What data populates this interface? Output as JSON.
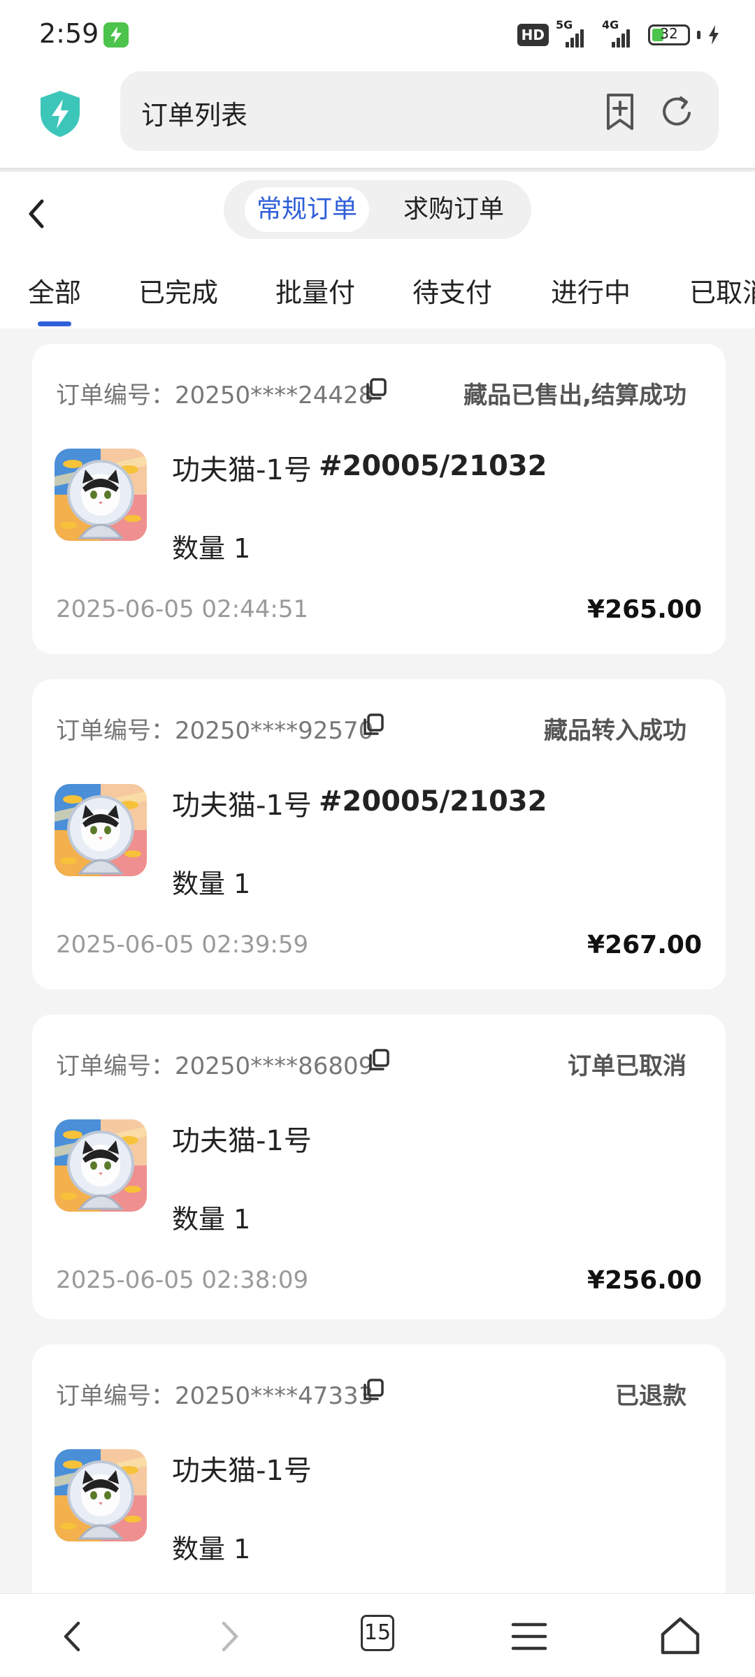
{
  "status_bar": {
    "time": "2:59",
    "network": "HD",
    "signal1": "5G",
    "signal2": "4G",
    "battery": "32"
  },
  "browser": {
    "url_title": "订单列表",
    "tab_count": "15"
  },
  "header": {
    "segments": [
      "常规订单",
      "求购订单"
    ],
    "active_segment": "常规订单",
    "tabs": [
      "全部",
      "已完成",
      "批量付",
      "待支付",
      "进行中",
      "已取消"
    ],
    "active_tab": "全部"
  },
  "orders": [
    {
      "label": "订单编号：20250****24428",
      "status": "藏品已售出,结算成功",
      "name": "功夫猫-1号",
      "serial": "#20005/21032",
      "qty": "数量 1",
      "date": "2025-06-05 02:44:51",
      "price": "¥265.00"
    },
    {
      "label": "订单编号：20250****92570",
      "status": "藏品转入成功",
      "name": "功夫猫-1号",
      "serial": "#20005/21032",
      "qty": "数量 1",
      "date": "2025-06-05 02:39:59",
      "price": "¥267.00"
    },
    {
      "label": "订单编号：20250****86809",
      "status": "订单已取消",
      "name": "功夫猫-1号",
      "serial": "",
      "qty": "数量 1",
      "date": "2025-06-05 02:38:09",
      "price": "¥256.00"
    },
    {
      "label": "订单编号：20250****47333",
      "status": "已退款",
      "name": "功夫猫-1号",
      "serial": "",
      "qty": "数量 1",
      "date": "",
      "price": ""
    }
  ],
  "colors": {
    "accent": "#2f5fd9",
    "background": "#f4f4f4",
    "card": "#ffffff"
  },
  "icons": {
    "back": "chevron-left-icon",
    "copy": "copy-icon",
    "shield": "shield-bolt-icon",
    "bookmark": "bookmark-add-icon",
    "refresh": "refresh-icon",
    "home": "home-icon",
    "menu": "menu-icon"
  }
}
